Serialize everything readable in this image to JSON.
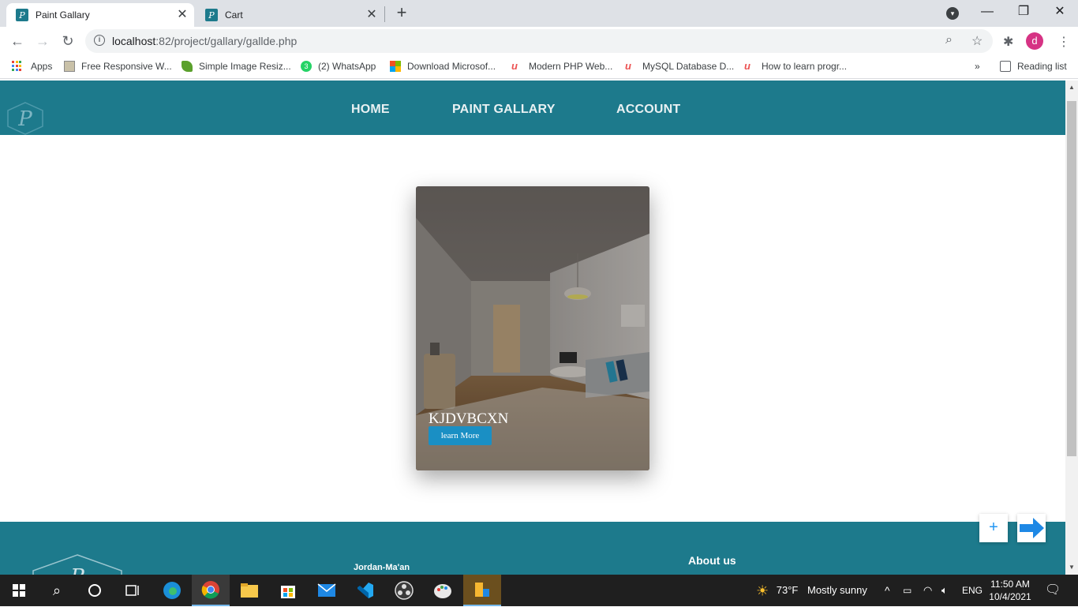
{
  "browser": {
    "tabs": [
      {
        "title": "Paint Gallary",
        "favicon": "P"
      },
      {
        "title": "Cart",
        "favicon": "P"
      }
    ],
    "url_host": "localhost",
    "url_path": ":82/project/gallary/gallde.php",
    "bookmarks": [
      {
        "label": "Apps",
        "icon": "apps-grid-icon"
      },
      {
        "label": "Free Responsive W...",
        "icon": "site-icon"
      },
      {
        "label": "Simple Image Resiz...",
        "icon": "leaf-icon"
      },
      {
        "label": "(2) WhatsApp",
        "icon": "whatsapp-icon"
      },
      {
        "label": "Download Microsof...",
        "icon": "microsoft-icon"
      },
      {
        "label": "Modern PHP Web...",
        "icon": "udemy-icon"
      },
      {
        "label": "MySQL Database D...",
        "icon": "udemy-icon"
      },
      {
        "label": "How to learn progr...",
        "icon": "udemy-icon"
      }
    ],
    "bookmarks_more": "»",
    "reading_list": "Reading list",
    "profile_initial": "d",
    "whatsapp_badge": "3"
  },
  "site": {
    "nav": {
      "home": "HOME",
      "gallery": "PAINT GALLARY",
      "account": "ACCOUNT"
    },
    "logo_letter": "P",
    "card": {
      "title": "KJDVBCXN",
      "button": "learn More"
    },
    "footer": {
      "text": "Jordan-Ma'an",
      "about": "About us"
    },
    "plus_button": "+"
  },
  "taskbar": {
    "weather_temp": "73°F",
    "weather_text": "Mostly sunny",
    "language": "ENG",
    "time": "11:50 AM",
    "date": "10/4/2021"
  },
  "colors": {
    "brand": "#1d7a8c",
    "button": "#1a8fc4"
  }
}
